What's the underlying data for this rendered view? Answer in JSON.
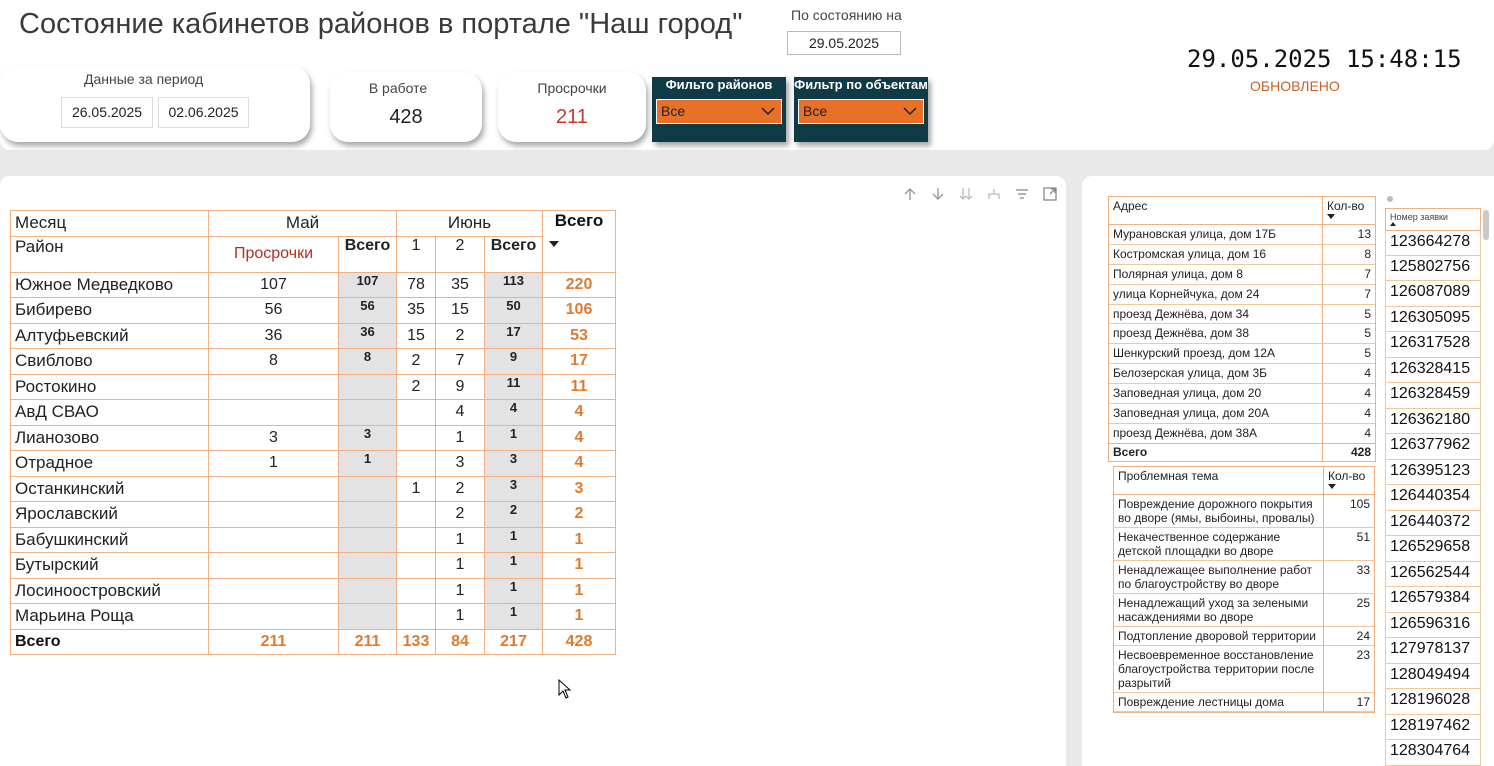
{
  "header": {
    "title": "Состояние кабинетов районов  в  портале \"Наш город\"",
    "as_of_label": "По состоянию на",
    "as_of_date": "29.05.2025",
    "period_label": "Данные за период",
    "period_from": "26.05.2025",
    "period_to": "02.06.2025",
    "in_work_label": "В работе",
    "in_work_value": "428",
    "overdue_label": "Просрочки",
    "overdue_value": "211",
    "filter_districts_title": "Фильто районов",
    "filter_districts_value": "Все",
    "filter_objects_title": "Фильтр по объектам",
    "filter_objects_value": "Все",
    "clock": "29.05.2025 15:48:15",
    "updated_label": "ОБНОВЛЕНО"
  },
  "colors": {
    "accent_orange": "#e8712a",
    "filter_bg": "#0e3b45",
    "overdue_red": "#c0392b",
    "grid_border": "#f0b080"
  },
  "toolbar_icons": [
    "arrow-up-icon",
    "arrow-down-icon",
    "double-arrow-down-icon",
    "hierarchy-icon",
    "filter-icon",
    "focus-mode-icon"
  ],
  "matrix": {
    "h_month": "Месяц",
    "h_may": "Май",
    "h_june": "Июнь",
    "h_total": "Всего",
    "h_district": "Район",
    "h_overdue": "Просрочки",
    "h_may_total": "Всего",
    "h_j1": "1",
    "h_j2": "2",
    "h_june_total": "Всего",
    "rows": [
      {
        "name": "Южное Медведково",
        "may": "107",
        "may_total": "107",
        "j1": "78",
        "j2": "35",
        "june_total": "113",
        "total": "220"
      },
      {
        "name": "Бибирево",
        "may": "56",
        "may_total": "56",
        "j1": "35",
        "j2": "15",
        "june_total": "50",
        "total": "106"
      },
      {
        "name": "Алтуфьевский",
        "may": "36",
        "may_total": "36",
        "j1": "15",
        "j2": "2",
        "june_total": "17",
        "total": "53"
      },
      {
        "name": "Свиблово",
        "may": "8",
        "may_total": "8",
        "j1": "2",
        "j2": "7",
        "june_total": "9",
        "total": "17"
      },
      {
        "name": "Ростокино",
        "may": "",
        "may_total": "",
        "j1": "2",
        "j2": "9",
        "june_total": "11",
        "total": "11"
      },
      {
        "name": "АвД СВАО",
        "may": "",
        "may_total": "",
        "j1": "",
        "j2": "4",
        "june_total": "4",
        "total": "4"
      },
      {
        "name": "Лианозово",
        "may": "3",
        "may_total": "3",
        "j1": "",
        "j2": "1",
        "june_total": "1",
        "total": "4"
      },
      {
        "name": "Отрадное",
        "may": "1",
        "may_total": "1",
        "j1": "",
        "j2": "3",
        "june_total": "3",
        "total": "4"
      },
      {
        "name": "Останкинский",
        "may": "",
        "may_total": "",
        "j1": "1",
        "j2": "2",
        "june_total": "3",
        "total": "3"
      },
      {
        "name": "Ярославский",
        "may": "",
        "may_total": "",
        "j1": "",
        "j2": "2",
        "june_total": "2",
        "total": "2"
      },
      {
        "name": "Бабушкинский",
        "may": "",
        "may_total": "",
        "j1": "",
        "j2": "1",
        "june_total": "1",
        "total": "1"
      },
      {
        "name": "Бутырский",
        "may": "",
        "may_total": "",
        "j1": "",
        "j2": "1",
        "june_total": "1",
        "total": "1"
      },
      {
        "name": "Лосиноостровский",
        "may": "",
        "may_total": "",
        "j1": "",
        "j2": "1",
        "june_total": "1",
        "total": "1"
      },
      {
        "name": "Марьина Роща",
        "may": "",
        "may_total": "",
        "j1": "",
        "j2": "1",
        "june_total": "1",
        "total": "1"
      }
    ],
    "total_row": {
      "name": "Всего",
      "may": "211",
      "may_total": "211",
      "j1": "133",
      "j2": "84",
      "june_total": "217",
      "total": "428"
    }
  },
  "addresses": {
    "h_address": "Адрес",
    "h_qty": "Кол-во",
    "rows": [
      {
        "address": "Мурановская улица, дом 17Б",
        "qty": "13"
      },
      {
        "address": "Костромская улица, дом 16",
        "qty": "8"
      },
      {
        "address": "Полярная улица, дом 8",
        "qty": "7"
      },
      {
        "address": "улица Корнейчука, дом 24",
        "qty": "7"
      },
      {
        "address": "проезд Дежнёва, дом 34",
        "qty": "5"
      },
      {
        "address": "проезд Дежнёва, дом 38",
        "qty": "5"
      },
      {
        "address": "Шенкурский проезд, дом 12А",
        "qty": "5"
      },
      {
        "address": "Белозерская улица, дом 3Б",
        "qty": "4"
      },
      {
        "address": "Заповедная улица, дом 20",
        "qty": "4"
      },
      {
        "address": "Заповедная улица, дом 20А",
        "qty": "4"
      },
      {
        "address": "проезд Дежнёва, дом 38А",
        "qty": "4"
      }
    ],
    "total_label": "Всего",
    "total_value": "428"
  },
  "topics": {
    "h_topic": "Проблемная тема",
    "h_qty": "Кол-во",
    "rows": [
      {
        "topic": "Повреждение дорожного покрытия во дворе (ямы, выбоины, провалы)",
        "qty": "105"
      },
      {
        "topic": "Некачественное содержание детской площадки во дворе",
        "qty": "51"
      },
      {
        "topic": "Ненадлежащее выполнение работ по благоустройству во дворе",
        "qty": "33"
      },
      {
        "topic": "Ненадлежащий уход за зелеными насаждениями во дворе",
        "qty": "25"
      },
      {
        "topic": "Подтопление дворовой территории",
        "qty": "24"
      },
      {
        "topic": "Несвоевременное восстановление благоустройства территории после разрытий",
        "qty": "23"
      },
      {
        "topic": "Повреждение лестницы дома",
        "qty": "17"
      }
    ]
  },
  "tickets": {
    "h_ticket": "Номер заявки",
    "rows": [
      "123664278",
      "125802756",
      "126087089",
      "126305095",
      "126317528",
      "126328415",
      "126328459",
      "126362180",
      "126377962",
      "126395123",
      "126440354",
      "126440372",
      "126529658",
      "126562544",
      "126579384",
      "126596316",
      "127978137",
      "128049494",
      "128196028",
      "128197462",
      "128304764"
    ]
  }
}
